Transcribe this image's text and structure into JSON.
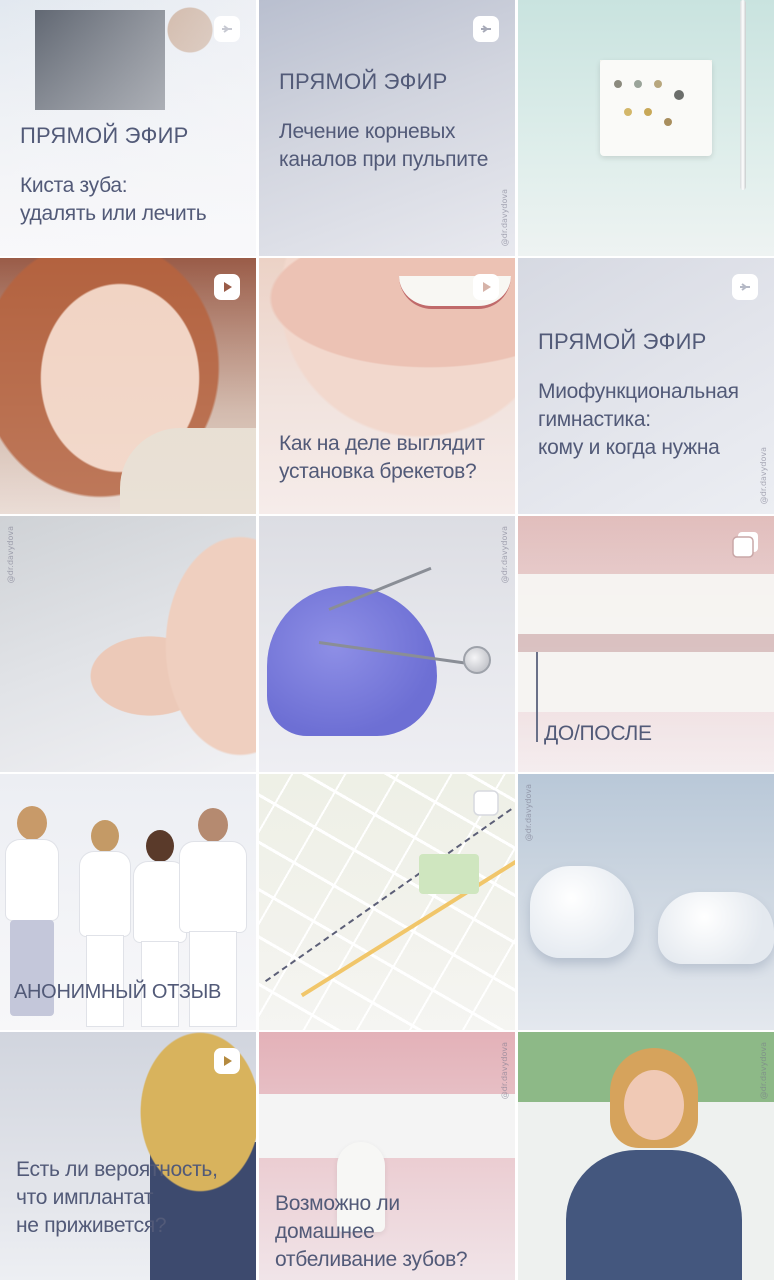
{
  "profile_grid": {
    "handle_text": "@dr.davydova",
    "tiles": [
      {
        "id": "t1",
        "kicker": "ПРЯМОЙ ЭФИР",
        "caption": "Киста зуба:\nудалять или лечить",
        "badge": "reels-icon",
        "colors": [
          "#dfe6ee",
          "#f4f4f6"
        ]
      },
      {
        "id": "t2",
        "kicker": "ПРЯМОЙ ЭФИР",
        "caption": "Лечение корневых\nканалов при пульпите",
        "badge": "reels-icon",
        "colors": [
          "#b9bfcf",
          "#e8e9ef"
        ]
      },
      {
        "id": "t3",
        "kicker": "",
        "caption": "",
        "badge": "",
        "colors": [
          "#c9e3df",
          "#eef3f2"
        ]
      },
      {
        "id": "t4",
        "kicker": "",
        "caption": "",
        "badge": "reels-icon",
        "colors": [
          "#9a5c48",
          "#e7d7cf"
        ]
      },
      {
        "id": "t5",
        "kicker": "",
        "caption": "Как на деле выглядит\nустановка брекетов?",
        "badge": "reels-icon",
        "colors": [
          "#ecd2c6",
          "#f6ecea"
        ]
      },
      {
        "id": "t6",
        "kicker": "ПРЯМОЙ ЭФИР",
        "caption": "Миофункциональная\nгимнастика:\nкому и когда нужна",
        "badge": "reels-icon",
        "colors": [
          "#d6d9e2",
          "#eceef3"
        ]
      },
      {
        "id": "t7",
        "kicker": "",
        "caption": "",
        "badge": "",
        "colors": [
          "#cfd2d6",
          "#f1f1f4"
        ]
      },
      {
        "id": "t8",
        "kicker": "",
        "caption": "",
        "badge": "",
        "colors": [
          "#dcdde3",
          "#eeeef3"
        ]
      },
      {
        "id": "t9",
        "kicker": "",
        "caption": "ДО/ПОСЛЕ",
        "badge": "carousel-icon",
        "colors": [
          "#d7a8a6",
          "#efe3e6"
        ]
      },
      {
        "id": "t10",
        "kicker": "",
        "caption": "АНОНИМНЫЙ ОТЗЫВ",
        "badge": "",
        "colors": [
          "#eceef3",
          "#f7f7f9"
        ]
      },
      {
        "id": "t11",
        "kicker": "",
        "caption": "",
        "badge": "carousel-icon",
        "colors": [
          "#eef0e6",
          "#f5f5f2"
        ]
      },
      {
        "id": "t12",
        "kicker": "",
        "caption": "",
        "badge": "",
        "colors": [
          "#b9c8d8",
          "#e4e8ee"
        ]
      },
      {
        "id": "t13",
        "kicker": "",
        "caption": "Есть ли вероятность,\nчто имплантат\nне приживется?",
        "badge": "reels-icon",
        "colors": [
          "#d1d5de",
          "#eef0f4"
        ]
      },
      {
        "id": "t14",
        "kicker": "",
        "caption": "Возможно ли домашнее\nотбеливание зубов?",
        "badge": "",
        "colors": [
          "#e3b1b8",
          "#f1e6ea"
        ]
      },
      {
        "id": "t15",
        "kicker": "",
        "caption": "",
        "badge": "",
        "colors": [
          "#8db987",
          "#f4f4f6"
        ]
      }
    ]
  }
}
